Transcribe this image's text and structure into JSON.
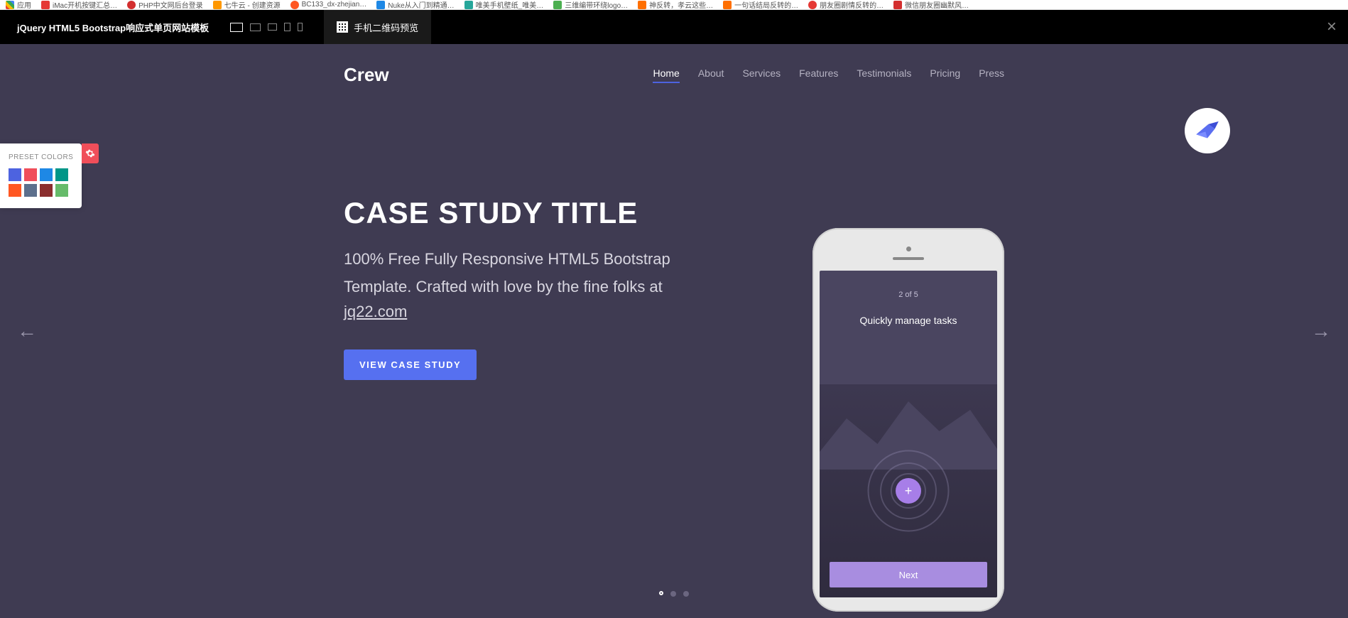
{
  "bookmarks": {
    "apps": "应用",
    "items": [
      "iMac开机按键汇总…",
      "PHP中文网后台登录",
      "七牛云 - 创建资源",
      "BC133_dx-zhejian…",
      "Nuke从入门到精通…",
      "唯美手机壁纸_唯美…",
      "三维编带环绕logo…",
      "神反转，孝云这些…",
      "一句话结局反转的…",
      "朋友圈剧情反转的…",
      "微信朋友圈幽默风…"
    ]
  },
  "preview_bar": {
    "title": "jQuery HTML5 Bootstrap响应式单页网站模板",
    "qr_label": "手机二维码预览"
  },
  "site": {
    "logo": "Crew",
    "nav": [
      "Home",
      "About",
      "Services",
      "Features",
      "Testimonials",
      "Pricing",
      "Press"
    ]
  },
  "hero": {
    "title": "CASE STUDY TITLE",
    "desc1": "100% Free Fully Responsive HTML5 Bootstrap",
    "desc2": "Template. Crafted with love by the fine folks at",
    "link": "jq22.com",
    "button": "VIEW CASE STUDY"
  },
  "phone": {
    "page_indicator": "2 of 5",
    "screen_title": "Quickly manage tasks",
    "next": "Next"
  },
  "preset": {
    "title": "PRESET COLORS",
    "colors_row1": [
      "#4d63e0",
      "#f04e5a",
      "#1e88e5",
      "#009688"
    ],
    "colors_row2": [
      "#ff5722",
      "#5c6f8c",
      "#8b2e2e",
      "#66bb6a"
    ]
  }
}
